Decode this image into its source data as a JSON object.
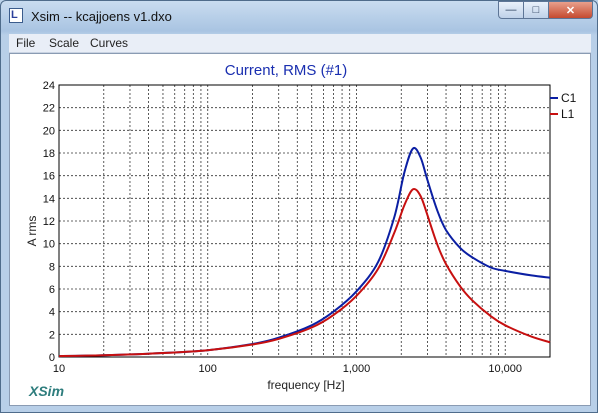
{
  "window": {
    "title": "Xsim -- kcajjoens v1.dxo",
    "app_icon_glyph": "L",
    "buttons": {
      "minimize_glyph": "—",
      "maximize_glyph": "□",
      "close_glyph": "✕"
    }
  },
  "menu": {
    "items": [
      "File",
      "Scale",
      "Curves"
    ]
  },
  "brand": {
    "label": "XSim",
    "color": "#2e7d7d"
  },
  "chart_data": {
    "type": "line",
    "title": "Current, RMS (#1)",
    "xlabel": "frequency [Hz]",
    "ylabel": "A rms",
    "x_scale": "log",
    "xlim": [
      10,
      20000
    ],
    "ylim": [
      0,
      24
    ],
    "grid": true,
    "legend_position": "right",
    "y_ticks": [
      0,
      2,
      4,
      6,
      8,
      10,
      12,
      14,
      16,
      18,
      20,
      22,
      24
    ],
    "x_tick_labels": [
      {
        "value": 10,
        "label": "10"
      },
      {
        "value": 100,
        "label": "100"
      },
      {
        "value": 1000,
        "label": "1,000"
      },
      {
        "value": 10000,
        "label": "10,000"
      }
    ],
    "series": [
      {
        "name": "C1",
        "color": "#0b1fa3",
        "points": [
          [
            10,
            0.08
          ],
          [
            20,
            0.15
          ],
          [
            50,
            0.35
          ],
          [
            100,
            0.6
          ],
          [
            200,
            1.15
          ],
          [
            300,
            1.7
          ],
          [
            500,
            2.8
          ],
          [
            700,
            4.0
          ],
          [
            1000,
            5.8
          ],
          [
            1400,
            8.4
          ],
          [
            1800,
            12.4
          ],
          [
            2100,
            16.3
          ],
          [
            2400,
            18.4
          ],
          [
            2700,
            17.6
          ],
          [
            3000,
            15.6
          ],
          [
            3500,
            12.9
          ],
          [
            4000,
            11.2
          ],
          [
            5000,
            9.6
          ],
          [
            6000,
            8.8
          ],
          [
            8000,
            7.9
          ],
          [
            10000,
            7.6
          ],
          [
            15000,
            7.2
          ],
          [
            20000,
            7.0
          ]
        ]
      },
      {
        "name": "L1",
        "color": "#c71010",
        "points": [
          [
            10,
            0.08
          ],
          [
            20,
            0.15
          ],
          [
            50,
            0.35
          ],
          [
            100,
            0.6
          ],
          [
            200,
            1.1
          ],
          [
            300,
            1.6
          ],
          [
            500,
            2.6
          ],
          [
            700,
            3.7
          ],
          [
            1000,
            5.4
          ],
          [
            1400,
            7.8
          ],
          [
            1800,
            11.0
          ],
          [
            2100,
            13.4
          ],
          [
            2400,
            14.8
          ],
          [
            2700,
            14.2
          ],
          [
            3000,
            12.5
          ],
          [
            3500,
            9.9
          ],
          [
            4000,
            8.2
          ],
          [
            5000,
            6.2
          ],
          [
            6000,
            5.0
          ],
          [
            8000,
            3.6
          ],
          [
            10000,
            2.8
          ],
          [
            15000,
            1.8
          ],
          [
            20000,
            1.3
          ]
        ]
      }
    ]
  }
}
